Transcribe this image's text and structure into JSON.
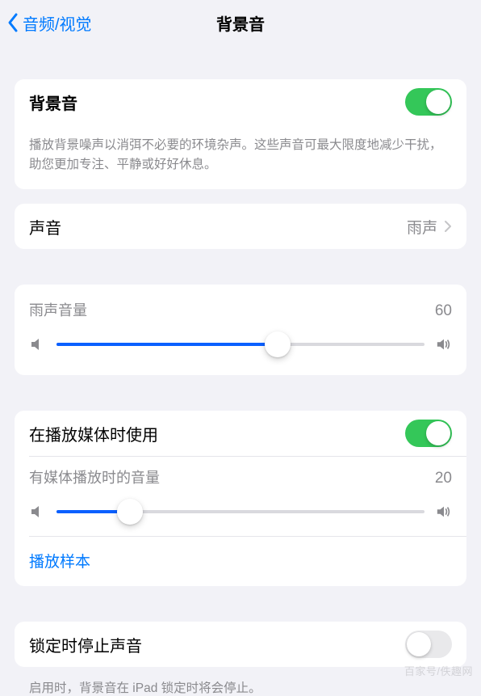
{
  "header": {
    "back_label": "音频/视觉",
    "title": "背景音"
  },
  "main_toggle": {
    "label": "背景音",
    "on": true,
    "description": "播放背景噪声以消弭不必要的环境杂声。这些声音可最大限度地减少干扰，助您更加专注、平静或好好休息。"
  },
  "sound_row": {
    "label": "声音",
    "value": "雨声"
  },
  "volume1": {
    "label": "雨声音量",
    "value": 60
  },
  "media_use": {
    "label": "在播放媒体时使用",
    "on": true
  },
  "volume2": {
    "label": "有媒体播放时的音量",
    "value": 20
  },
  "sample_link": "播放样本",
  "lock_stop": {
    "label": "锁定时停止声音",
    "on": false,
    "description": "启用时，背景音在 iPad 锁定时将会停止。"
  },
  "watermark": "百家号/佚趣网"
}
